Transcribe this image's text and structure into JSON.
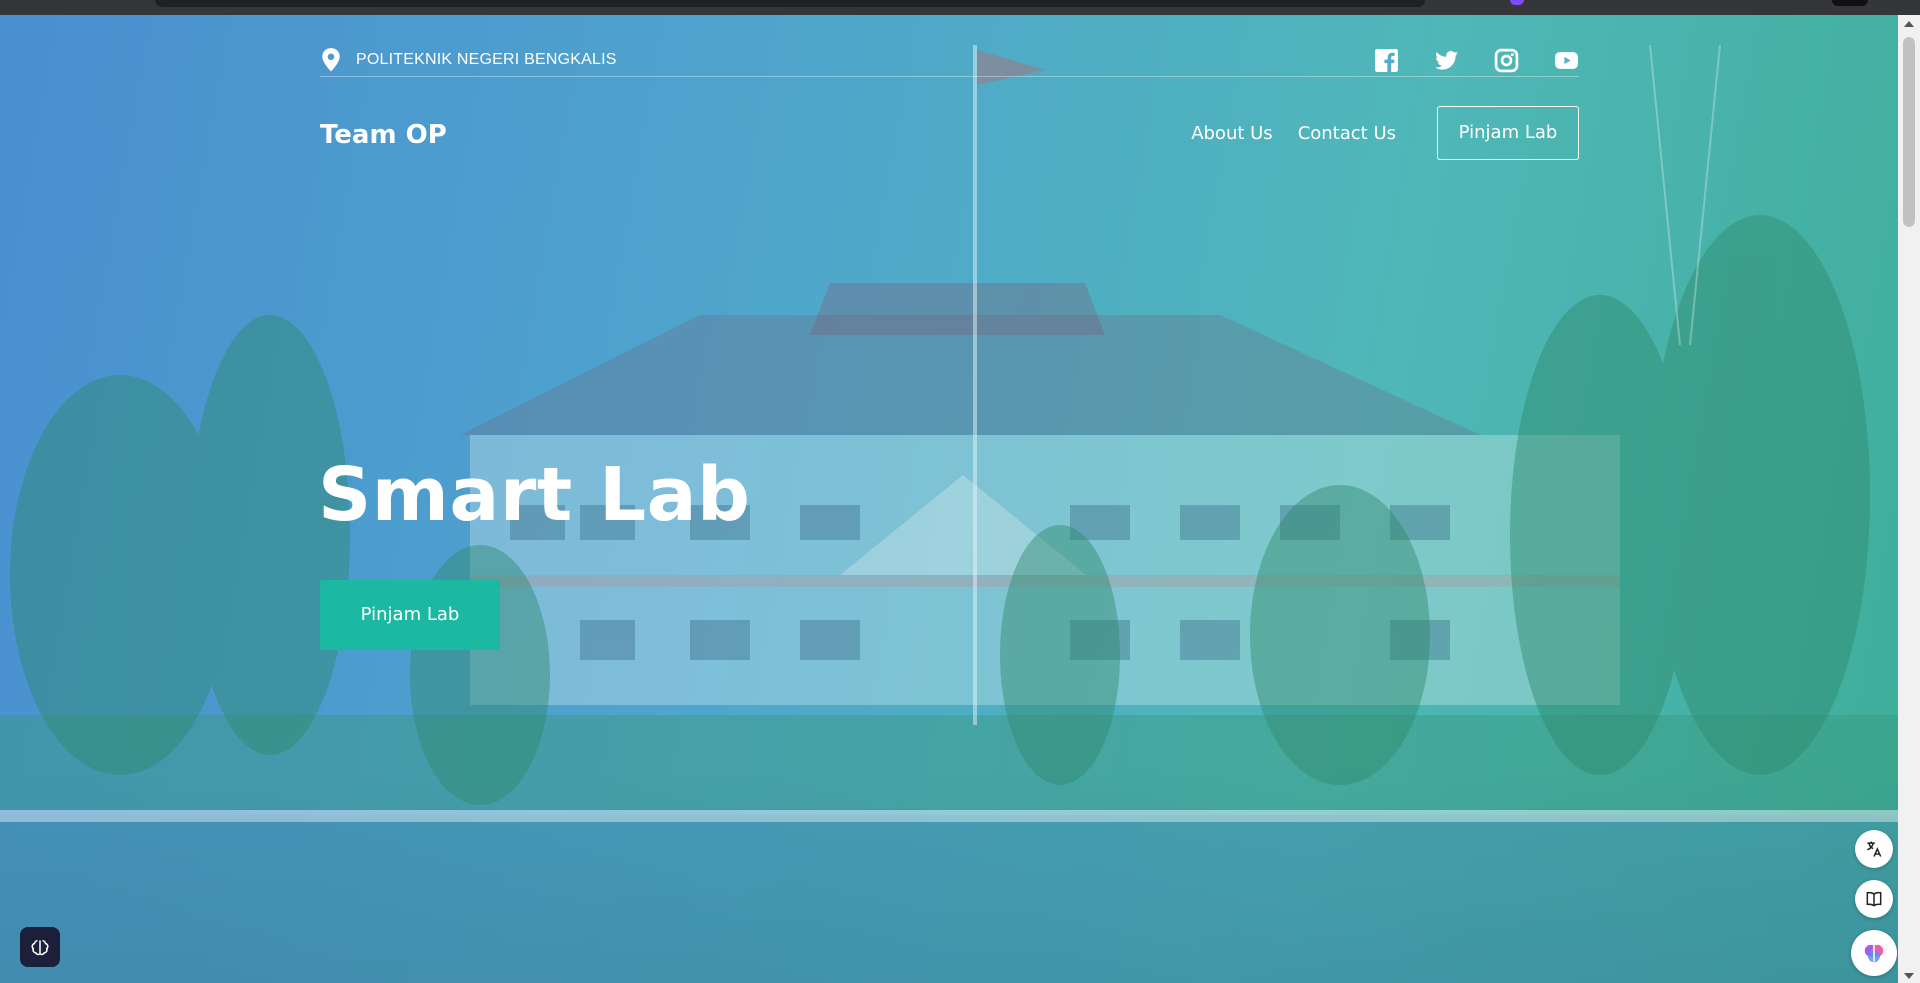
{
  "site": {
    "location_text": "POLITEKNIK NEGERI BENGKALIS",
    "brand": "Team OP"
  },
  "nav": {
    "links": [
      "About Us",
      "Contact Us"
    ],
    "cta": "Pinjam Lab"
  },
  "socials": [
    "facebook-icon",
    "twitter-icon",
    "instagram-icon",
    "youtube-icon"
  ],
  "hero": {
    "title": "Smart Lab",
    "button": "Pinjam Lab"
  },
  "side_tools": [
    "translate-icon",
    "book-icon",
    "brain-icon"
  ],
  "colors": {
    "accent": "#1cb9a2",
    "gradient_start": "#4a8fd0",
    "gradient_end": "#3fae9a"
  }
}
